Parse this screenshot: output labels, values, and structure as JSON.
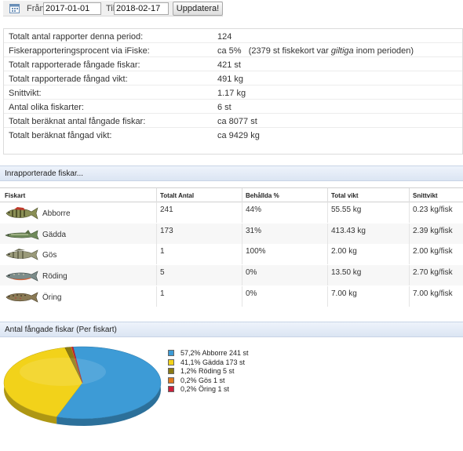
{
  "filter": {
    "from_label": "Från:",
    "from_value": "2017-01-01",
    "to_label": "Till:",
    "to_value": "2018-02-17",
    "update_button": "Uppdatera!"
  },
  "summary": {
    "rows": [
      {
        "label": "Totalt antal rapporter denna period:",
        "value": "124"
      },
      {
        "label": "Fiskerapporteringsprocent via iFiske:",
        "value": "ca 5%   (2379 st fiskekort var ",
        "value_em": "giltiga",
        "value_tail": " inom perioden)"
      },
      {
        "label": "Totalt rapporterade fångade fiskar:",
        "value": "421 st"
      },
      {
        "label": "Totalt rapporterade fångad vikt:",
        "value": "491 kg"
      },
      {
        "label": "Snittvikt:",
        "value": "1.17 kg"
      },
      {
        "label": "Antal olika fiskarter:",
        "value": "6 st"
      },
      {
        "label": "Totalt beräknat antal fångade fiskar:",
        "value": "ca 8077 st"
      },
      {
        "label": "Totalt beräknat fångad vikt:",
        "value": "ca 9429 kg"
      }
    ]
  },
  "reported_section": {
    "title": "Inrapporterade fiskar..."
  },
  "fish_table": {
    "columns": [
      "Fiskart",
      "Totalt Antal",
      "Behållda %",
      "Total vikt",
      "Snittvikt"
    ],
    "rows": [
      {
        "species": "Abborre",
        "count": "241",
        "kept": "44%",
        "total_weight": "55.55 kg",
        "avg_weight": "0.23 kg/fisk"
      },
      {
        "species": "Gädda",
        "count": "173",
        "kept": "31%",
        "total_weight": "413.43 kg",
        "avg_weight": "2.39 kg/fisk"
      },
      {
        "species": "Gös",
        "count": "1",
        "kept": "100%",
        "total_weight": "2.00 kg",
        "avg_weight": "2.00 kg/fisk"
      },
      {
        "species": "Röding",
        "count": "5",
        "kept": "0%",
        "total_weight": "13.50 kg",
        "avg_weight": "2.70 kg/fisk"
      },
      {
        "species": "Öring",
        "count": "1",
        "kept": "0%",
        "total_weight": "7.00 kg",
        "avg_weight": "7.00 kg/fisk"
      }
    ]
  },
  "pie_section": {
    "title": "Antal fångade fiskar (Per fiskart)"
  },
  "chart_data": {
    "type": "pie",
    "series": [
      {
        "name": "Abborre",
        "value": 241,
        "color": "#3d9bd6",
        "legend": "57,2% Abborre 241 st"
      },
      {
        "name": "Gädda",
        "value": 173,
        "color": "#f2d21a",
        "legend": "41,1% Gädda 173 st"
      },
      {
        "name": "Röding",
        "value": 5,
        "color": "#8a7a14",
        "legend": "1,2% Röding 5 st"
      },
      {
        "name": "Gös",
        "value": 1,
        "color": "#e07a1f",
        "legend": "0,2% Gös 1 st"
      },
      {
        "name": "Öring",
        "value": 1,
        "color": "#cc1f3a",
        "legend": "0,2% Öring 1 st"
      }
    ]
  },
  "icons": {
    "calendar": "calendar-icon",
    "fish": "fish-icon"
  }
}
